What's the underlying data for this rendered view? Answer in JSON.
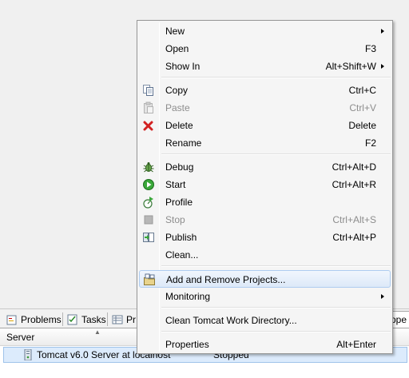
{
  "view_tabs": [
    {
      "label": "Problems",
      "icon": "problems-icon"
    },
    {
      "label": "Tasks",
      "icon": "tasks-icon"
    },
    {
      "label": "Pr",
      "icon": "properties-icon"
    },
    {
      "label": "ppe",
      "icon": "servers-icon"
    }
  ],
  "servers_table": {
    "columns": [
      "Server",
      ""
    ],
    "rows": [
      {
        "server": "Tomcat v6.0 Server at localhost",
        "state": "Stopped"
      }
    ]
  },
  "context_menu": {
    "items": [
      {
        "label": "New",
        "accel": "",
        "submenu": true,
        "enabled": true,
        "icon": ""
      },
      {
        "label": "Open",
        "accel": "F3",
        "submenu": false,
        "enabled": true,
        "icon": ""
      },
      {
        "label": "Show In",
        "accel": "Alt+Shift+W",
        "submenu": true,
        "enabled": true,
        "icon": ""
      },
      {
        "label": "Copy",
        "accel": "Ctrl+C",
        "submenu": false,
        "enabled": true,
        "icon": "copy-icon"
      },
      {
        "label": "Paste",
        "accel": "Ctrl+V",
        "submenu": false,
        "enabled": false,
        "icon": "paste-icon"
      },
      {
        "label": "Delete",
        "accel": "Delete",
        "submenu": false,
        "enabled": true,
        "icon": "delete-icon"
      },
      {
        "label": "Rename",
        "accel": "F2",
        "submenu": false,
        "enabled": true,
        "icon": ""
      },
      {
        "label": "Debug",
        "accel": "Ctrl+Alt+D",
        "submenu": false,
        "enabled": true,
        "icon": "debug-icon"
      },
      {
        "label": "Start",
        "accel": "Ctrl+Alt+R",
        "submenu": false,
        "enabled": true,
        "icon": "start-icon"
      },
      {
        "label": "Profile",
        "accel": "",
        "submenu": false,
        "enabled": true,
        "icon": "profile-icon"
      },
      {
        "label": "Stop",
        "accel": "Ctrl+Alt+S",
        "submenu": false,
        "enabled": false,
        "icon": "stop-icon"
      },
      {
        "label": "Publish",
        "accel": "Ctrl+Alt+P",
        "submenu": false,
        "enabled": true,
        "icon": "publish-icon"
      },
      {
        "label": "Clean...",
        "accel": "",
        "submenu": false,
        "enabled": true,
        "icon": ""
      },
      {
        "label": "Add and Remove Projects...",
        "accel": "",
        "submenu": false,
        "enabled": true,
        "icon": "add-remove-projects-icon",
        "highlighted": true
      },
      {
        "label": "Monitoring",
        "accel": "",
        "submenu": true,
        "enabled": true,
        "icon": ""
      },
      {
        "label": "Clean Tomcat Work Directory...",
        "accel": "",
        "submenu": false,
        "enabled": true,
        "icon": ""
      },
      {
        "label": "Properties",
        "accel": "Alt+Enter",
        "submenu": false,
        "enabled": true,
        "icon": ""
      }
    ]
  },
  "colors": {
    "menu_background": "#f5f5f5",
    "highlight_background": "#dde9f8",
    "highlight_border": "#aeccf0",
    "disabled_text": "#8d8d8d",
    "row_selected": "#dcebfc"
  }
}
